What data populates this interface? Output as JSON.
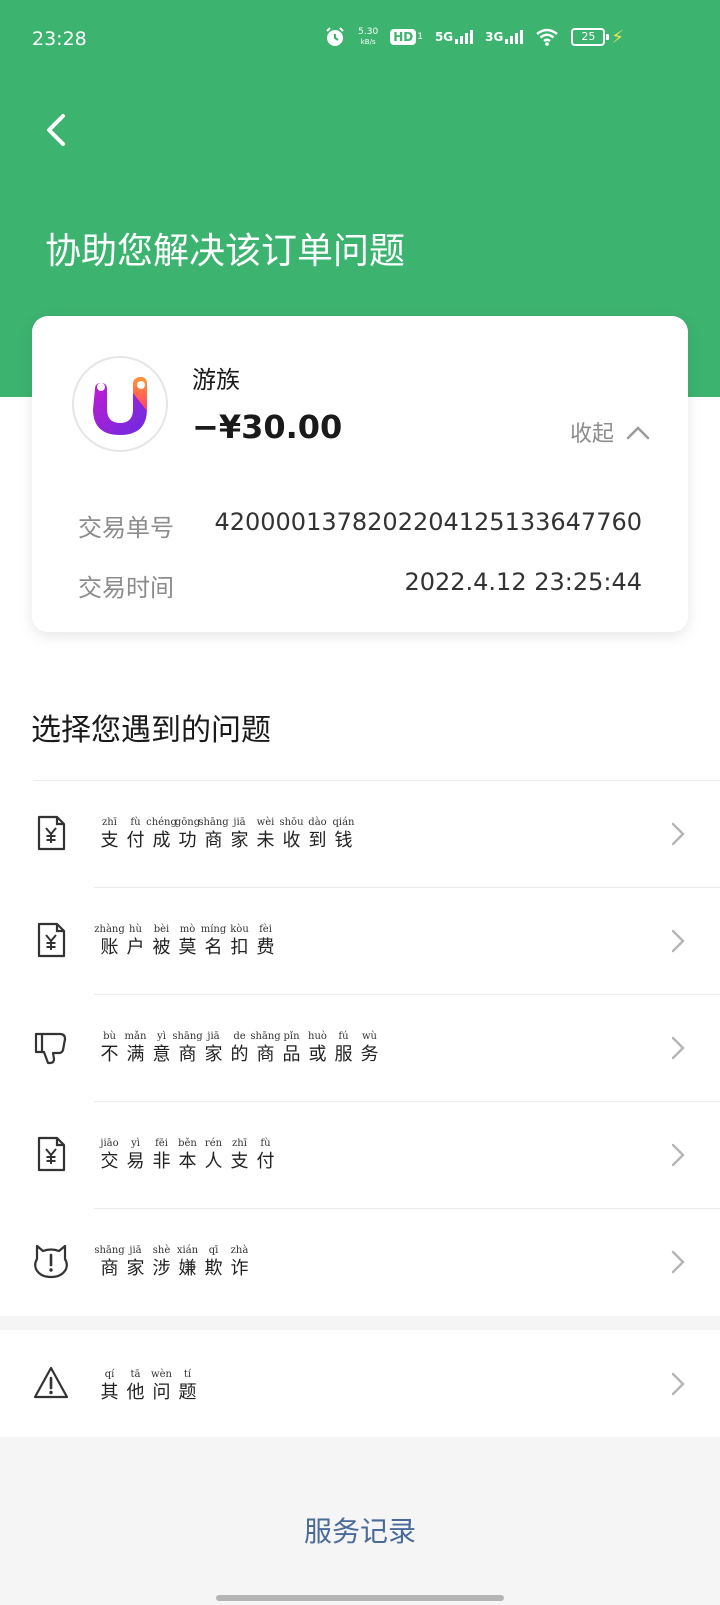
{
  "status_bar": {
    "time": "23:28",
    "net_speed_value": "5.30",
    "net_speed_unit": "kB/s",
    "hd_label": "HD",
    "hd_sub": "1",
    "signal1_label": "5G",
    "signal2_label": "3G",
    "battery_level": "25",
    "icons": [
      "alarm-icon",
      "wifi-icon",
      "battery-icon",
      "charging-bolt-icon"
    ]
  },
  "header": {
    "title": "协助您解决该订单问题",
    "back_icon": "chevron-left-icon",
    "background_color": "#3db370"
  },
  "order": {
    "merchant_name": "游族",
    "amount": "−¥30.00",
    "collapse_label": "收起",
    "details": [
      {
        "label": "交易单号",
        "value": "4200001378202204125133647760"
      },
      {
        "label": "交易时间",
        "value": "2022.4.12 23:25:44"
      }
    ]
  },
  "section": {
    "title": "选择您遇到的问题"
  },
  "issues": [
    {
      "icon": "yuan-document-icon",
      "pinyin": [
        "zhī",
        "fù",
        "chéng",
        "gōng",
        "shāng",
        "jiā",
        "wèi",
        "shōu",
        "dào",
        "qián"
      ],
      "chars": [
        "支",
        "付",
        "成",
        "功",
        "商",
        "家",
        "未",
        "收",
        "到",
        "钱"
      ]
    },
    {
      "icon": "yuan-document-icon",
      "pinyin": [
        "zhàng",
        "hù",
        "bèi",
        "mò",
        "míng",
        "kòu",
        "fèi"
      ],
      "chars": [
        "账",
        "户",
        "被",
        "莫",
        "名",
        "扣",
        "费"
      ]
    },
    {
      "icon": "thumbs-down-icon",
      "pinyin": [
        "bù",
        "mǎn",
        "yì",
        "shāng",
        "jiā",
        "de",
        "shāng",
        "pǐn",
        "huò",
        "fú",
        "wù"
      ],
      "chars": [
        "不",
        "满",
        "意",
        "商",
        "家",
        "的",
        "商",
        "品",
        "或",
        "服",
        "务"
      ]
    },
    {
      "icon": "yuan-document-icon",
      "pinyin": [
        "jiāo",
        "yì",
        "fēi",
        "běn",
        "rén",
        "zhī",
        "fù"
      ],
      "chars": [
        "交",
        "易",
        "非",
        "本",
        "人",
        "支",
        "付"
      ]
    },
    {
      "icon": "alert-cat-icon",
      "pinyin": [
        "shāng",
        "jiā",
        "shè",
        "xián",
        "qī",
        "zhà"
      ],
      "chars": [
        "商",
        "家",
        "涉",
        "嫌",
        "欺",
        "诈"
      ]
    }
  ],
  "other_issue": {
    "icon": "warning-triangle-icon",
    "pinyin": [
      "qí",
      "tā",
      "wèn",
      "tí"
    ],
    "chars": [
      "其",
      "他",
      "问",
      "题"
    ]
  },
  "footer": {
    "service_record_label": "服务记录"
  }
}
